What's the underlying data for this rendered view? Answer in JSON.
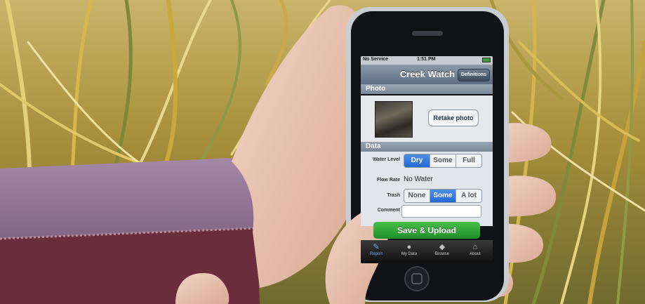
{
  "status_bar": {
    "carrier": "No Service",
    "time": "1:51 PM"
  },
  "nav_bar": {
    "title": "Creek Watch",
    "right_button": "Definitions"
  },
  "photo_section": {
    "header": "Photo",
    "retake_button": "Retake photo"
  },
  "data_section": {
    "header": "Data",
    "water_level": {
      "label": "Water Level",
      "options": [
        "Dry",
        "Some",
        "Full"
      ],
      "selected": "Dry"
    },
    "flow_rate": {
      "label": "Flow Rate",
      "value": "No Water"
    },
    "trash": {
      "label": "Trash",
      "options": [
        "None",
        "Some",
        "A lot"
      ],
      "selected": "Some"
    },
    "comment": {
      "label": "Comment",
      "value": ""
    }
  },
  "save_button": "Save & Upload",
  "tab_bar": {
    "items": [
      {
        "label": "Report",
        "icon": "pencil-icon"
      },
      {
        "label": "My Data",
        "icon": "person-icon"
      },
      {
        "label": "Browse",
        "icon": "map-pin-icon"
      },
      {
        "label": "About",
        "icon": "house-icon"
      }
    ],
    "active": "Report"
  }
}
